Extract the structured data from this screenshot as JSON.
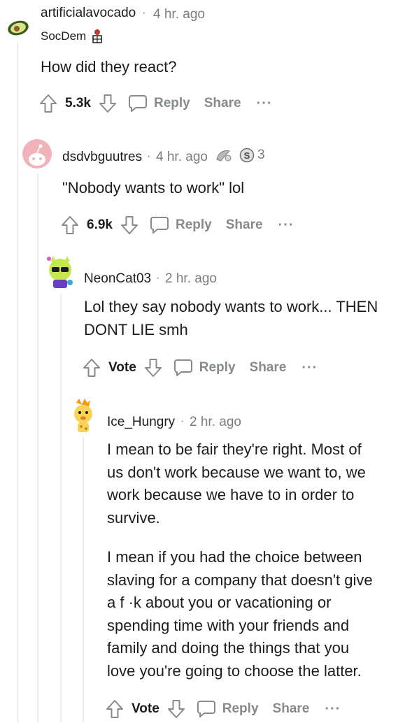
{
  "comments": [
    {
      "username": "artificialavocado",
      "time": "4 hr. ago",
      "flair": "SocDem",
      "body": [
        "How did they react?"
      ],
      "votes": "5.3k",
      "reply_label": "Reply",
      "share_label": "Share",
      "more_label": "···"
    },
    {
      "username": "dsdvbguutres",
      "time": "4 hr. ago",
      "award_count": "3",
      "body": [
        "\"Nobody wants to work\" lol"
      ],
      "votes": "6.9k",
      "reply_label": "Reply",
      "share_label": "Share",
      "more_label": "···"
    },
    {
      "username": "NeonCat03",
      "time": "2 hr. ago",
      "body": [
        "Lol they say nobody wants to work... THEN",
        "DONT LIE smh"
      ],
      "votes": "Vote",
      "reply_label": "Reply",
      "share_label": "Share",
      "more_label": "···"
    },
    {
      "username": "Ice_Hungry",
      "time": "2 hr. ago",
      "body": [
        "I mean to be fair they're right. Most of",
        "us don't work because we want to, we",
        "work because we have to in order to",
        "survive.",
        "I mean if you had the choice between",
        "slaving for a company that doesn't give",
        "a f  ·k about you or vacationing or",
        "spending time with your friends and",
        "family and doing the things that you",
        "love you're going to choose the latter."
      ],
      "votes": "Vote",
      "reply_label": "Reply",
      "share_label": "Share",
      "more_label": "···"
    }
  ],
  "separator": "·"
}
